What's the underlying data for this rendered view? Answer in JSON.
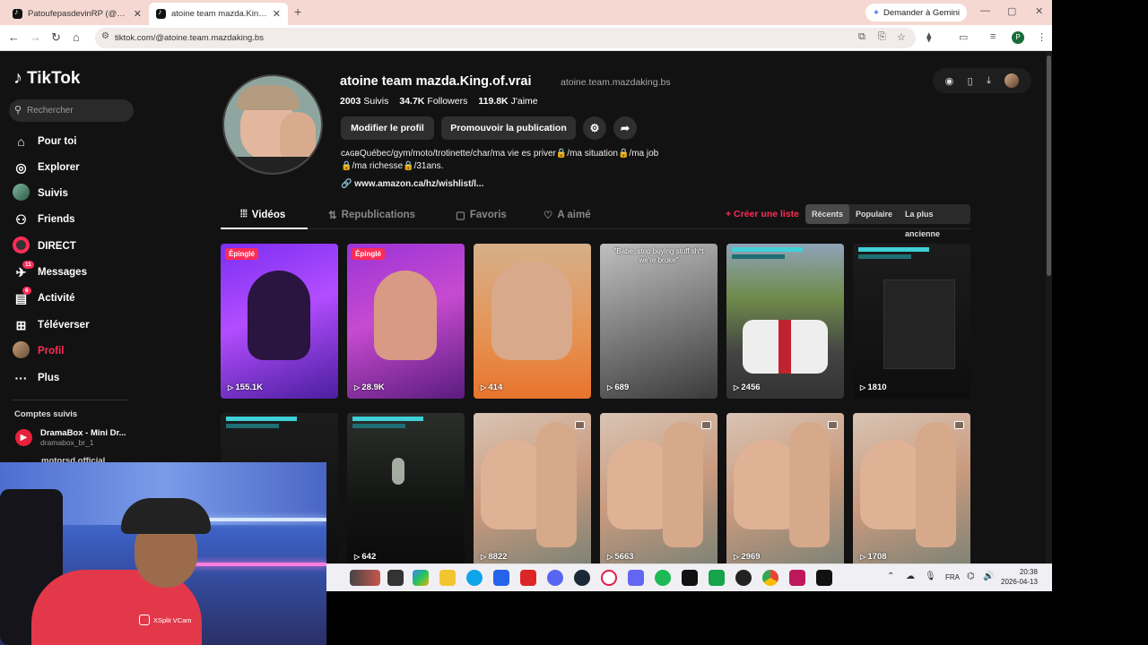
{
  "browser": {
    "tabs": [
      {
        "label": "PatoufepasdevinRP (@patoufe)",
        "active": false
      },
      {
        "label": "atoine team mazda.King.of.vrai",
        "active": true
      }
    ],
    "gemini_label": "Demander à Gemini",
    "url": "tiktok.com/@atoine.team.mazdaking.bs",
    "profile_letter": "P"
  },
  "sidebar": {
    "logo": "TikTok",
    "search_placeholder": "Rechercher",
    "items": [
      {
        "label": "Pour toi",
        "icon": "home-icon"
      },
      {
        "label": "Explorer",
        "icon": "compass-icon"
      },
      {
        "label": "Suivis",
        "icon": "following-icon"
      },
      {
        "label": "Friends",
        "icon": "friends-icon"
      },
      {
        "label": "DIRECT",
        "icon": "live-icon"
      },
      {
        "label": "Messages",
        "icon": "messages-icon",
        "badge": "11"
      },
      {
        "label": "Activité",
        "icon": "activity-icon",
        "badge": "6"
      },
      {
        "label": "Téléverser",
        "icon": "upload-icon"
      },
      {
        "label": "Profil",
        "icon": "profile-avatar",
        "active": true
      },
      {
        "label": "Plus",
        "icon": "more-icon"
      }
    ],
    "followed_title": "Comptes suivis",
    "followed": [
      {
        "name": "DramaBox - Mini Dr...",
        "handle": "dramabox_br_1"
      },
      {
        "name": "motorsd.official",
        "handle": ""
      }
    ]
  },
  "profile": {
    "display_name": "atoine team mazda.King.of.vrai",
    "handle": "atoine.team.mazdaking.bs",
    "following_count": "2003",
    "following_label": "Suivis",
    "followers_count": "34.7K",
    "followers_label": "Followers",
    "likes_count": "119.8K",
    "likes_label": "J'aime",
    "edit_button": "Modifier le profil",
    "promote_button": "Promouvoir la publication",
    "bio_line1": "ᴄᴀɢʙQuébec/gym/moto/trotinette/char/ma vie es priver🔒/ma situation🔒/ma job",
    "bio_line2": "🔒/ma richesse🔒/31ans.",
    "link": "www.amazon.ca/hz/wishlist/l..."
  },
  "tabs": {
    "videos": "Vidéos",
    "reposts": "Republications",
    "favorites": "Favoris",
    "liked": "A aimé",
    "create_list": "+ Créer une liste",
    "sort_recent": "Récents",
    "sort_popular": "Populaire",
    "sort_oldest": "La plus ancienne"
  },
  "videos": [
    {
      "views": "155.1K",
      "pinned": "Épinglé"
    },
    {
      "views": "28.9K",
      "pinned": "Épinglé"
    },
    {
      "views": "414"
    },
    {
      "views": "689",
      "caption": "\"Babe, stop buying stuff sh*t we're broke\""
    },
    {
      "views": "2456"
    },
    {
      "views": "1810"
    },
    {
      "views": ""
    },
    {
      "views": "642"
    },
    {
      "views": "8822"
    },
    {
      "views": "5663"
    },
    {
      "views": "2969"
    },
    {
      "views": "1708"
    }
  ],
  "webcam": {
    "label": "XSplit VCam"
  },
  "taskbar": {
    "lang": "FRA",
    "time": "20:38",
    "date": "2026-04-13"
  },
  "colors": {
    "accent": "#fe2c55",
    "page_bg": "#121212"
  }
}
